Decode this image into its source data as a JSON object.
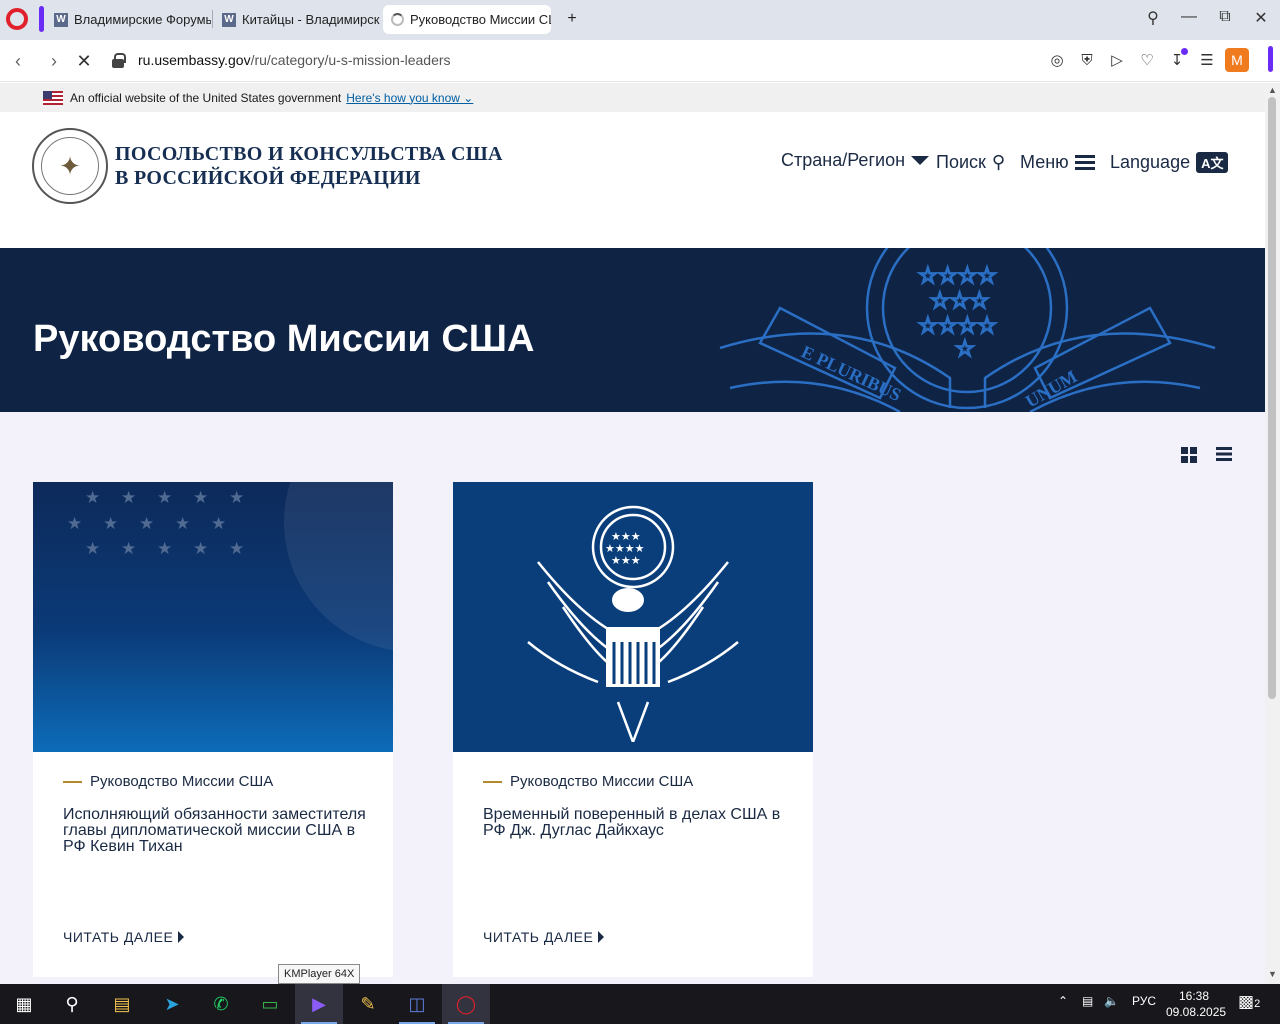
{
  "browser": {
    "tabs": [
      {
        "label": "Владимирские Форумы V",
        "favicon": "W"
      },
      {
        "label": "Китайцы - Владимирские",
        "favicon": "W"
      },
      {
        "label": "Руководство Миссии США",
        "favicon": "loading-spinner"
      }
    ],
    "new_tab_glyph": "+",
    "url_host": "ru.usembassy.gov",
    "url_path": "/ru/category/u-s-mission-leaders",
    "profile_initial": "M",
    "accent_color": "#6a2cf5"
  },
  "page": {
    "gov_banner": {
      "text": "An official website of the United States government",
      "link": "Here's how you know"
    },
    "site_title_line1": "ПОСОЛЬСТВО И КОНСУЛЬСТВА США",
    "site_title_line2": "В РОССИЙСКОЙ ФЕДЕРАЦИИ",
    "nav": {
      "country": "Страна/Регион",
      "search": "Поиск",
      "menu": "Меню",
      "language": "Language",
      "language_badge": "A文"
    },
    "hero_title": "Руководство Миссии США",
    "hero_motto_left": "E PLURIBUS",
    "hero_motto_right": "UNUM",
    "cards": [
      {
        "category": "Руководство Миссии США",
        "title": "Исполняющий обязанности заместителя главы дипломатической миссии США в РФ Кевин Тихан",
        "read_more": "ЧИТАТЬ ДАЛЕЕ"
      },
      {
        "category": "Руководство Миссии США",
        "title": "Временный поверенный в делах США в РФ Дж. Дуглас Дайкхаус",
        "read_more": "ЧИТАТЬ ДАЛЕЕ"
      }
    ],
    "colors": {
      "navy": "#0f2344",
      "gold": "#b38b2d",
      "page_bg": "#f3f2fb"
    }
  },
  "tooltip": "KMPlayer 64X",
  "taskbar": {
    "language": "РУС",
    "time": "16:38",
    "date": "09.08.2025",
    "notifications": "2"
  }
}
